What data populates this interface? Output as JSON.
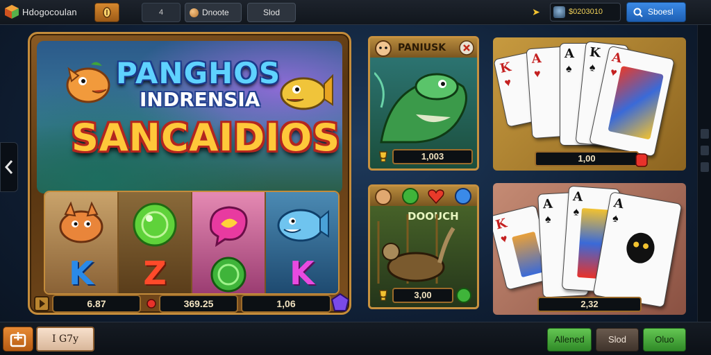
{
  "topbar": {
    "app_title": "Hdogocoulan",
    "tab_a": "4",
    "tab_b": "Dnoote",
    "tab_c": "Slod",
    "balance": "$0203010",
    "search_label": "Sboesl"
  },
  "main_game": {
    "title_line1": "PANGHOS",
    "title_line2": "INDRENSIA",
    "title_line3": "SANCAIDIOS",
    "reel_letters": [
      "K",
      "Z",
      "",
      "K"
    ],
    "stat_left": "6.87",
    "stat_mid": "369.25",
    "stat_right": "1,06"
  },
  "thumbnails": [
    {
      "title": "PANIUSK",
      "value": "1,003"
    },
    {
      "title": "DOOUCH",
      "value": "3,00"
    },
    {
      "value": "1,00"
    },
    {
      "value": "2,32"
    }
  ],
  "bottombar": {
    "play_label": "I G7y",
    "btn1": "Allened",
    "btn2": "Slod",
    "btn3": "Oluo"
  },
  "colors": {
    "frame_gold": "#c48c3b",
    "accent_blue": "#2f74cf",
    "accent_green": "#4aae3d",
    "accent_orange": "#d6782a"
  },
  "icons": {
    "logo": "cube-logo-icon",
    "coin": "coin-icon",
    "balance": "gold-arrow-icon",
    "search": "search-icon",
    "home": "home-icon"
  }
}
